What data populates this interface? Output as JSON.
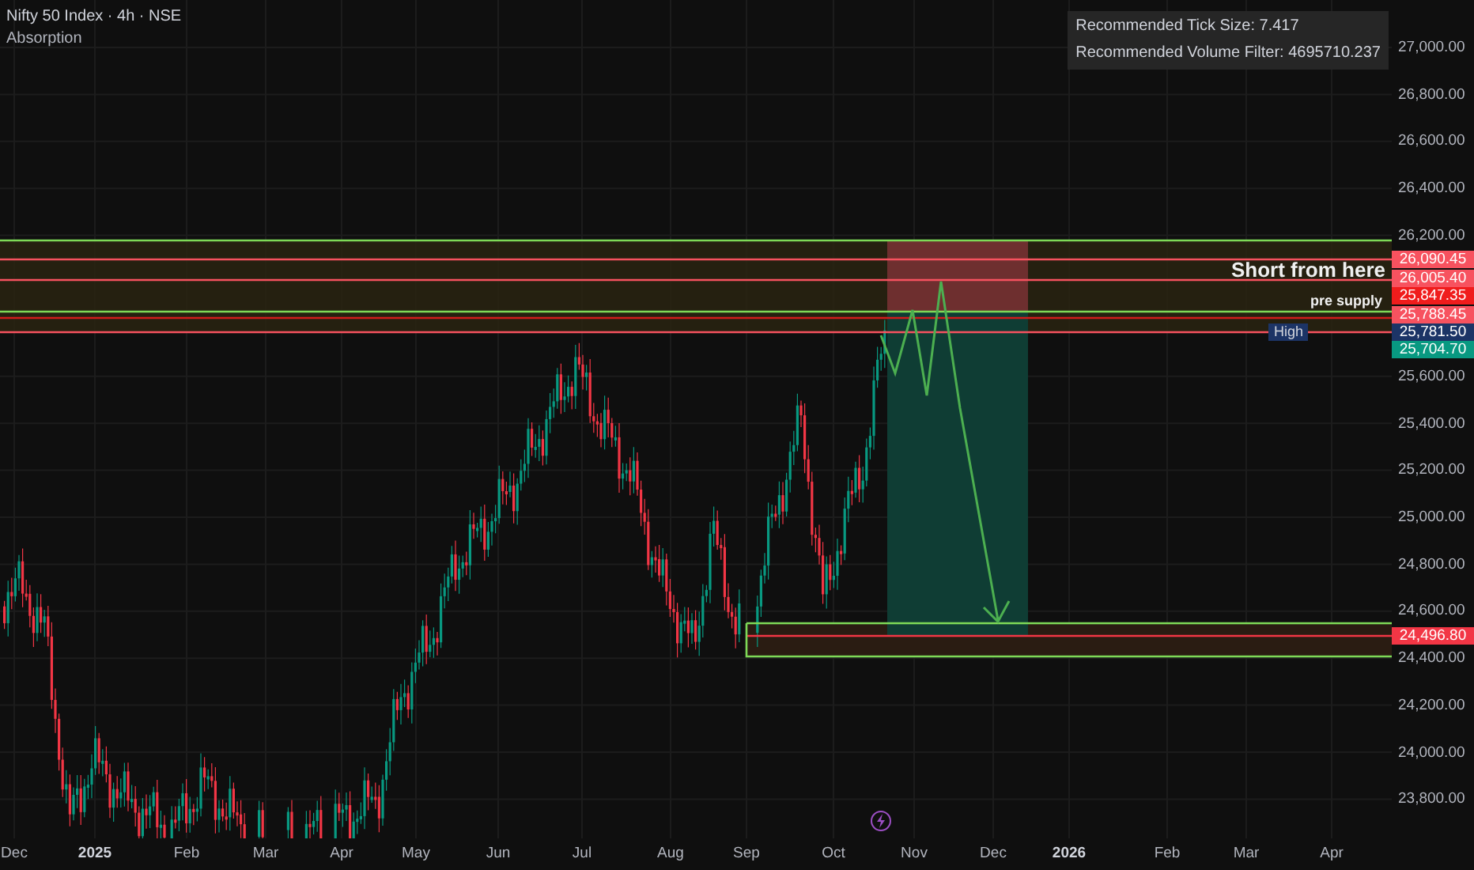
{
  "header": {
    "title": "Nifty 50 Index · 4h · NSE",
    "indicator": "Absorption"
  },
  "info_panel": [
    "Recommended Tick Size: 7.417",
    "Recommended Volume Filter: 4695710.237"
  ],
  "annotations": [
    {
      "kind": "headline",
      "text": "Short from here"
    },
    {
      "kind": "note",
      "text": "pre supply"
    }
  ],
  "price_axis": {
    "ticks": [
      "27,000.00",
      "26,800.00",
      "26,600.00",
      "26,400.00",
      "26,200.00",
      "25,600.00",
      "25,400.00",
      "25,200.00",
      "25,000.00",
      "24,800.00",
      "24,600.00",
      "24,400.00",
      "24,200.00",
      "24,000.00",
      "23,800.00"
    ],
    "tags": [
      {
        "label": "26,090.45",
        "color": "#f7525f"
      },
      {
        "label": "26,005.40",
        "color": "#f7525f"
      },
      {
        "label": "25,847.35",
        "color": "#f01c1c"
      },
      {
        "label": "25,788.45",
        "color": "#f7525f"
      },
      {
        "badge": "High",
        "label": "25,781.50",
        "color": "#1c3466"
      },
      {
        "label": "25,704.70",
        "color": "#089981"
      },
      {
        "label": "24,496.80",
        "color": "#f23645"
      }
    ]
  },
  "time_axis": [
    {
      "text": "Dec",
      "kind": "month"
    },
    {
      "text": "2025",
      "kind": "year"
    },
    {
      "text": "Feb",
      "kind": "month"
    },
    {
      "text": "Mar",
      "kind": "month"
    },
    {
      "text": "Apr",
      "kind": "month"
    },
    {
      "text": "May",
      "kind": "month"
    },
    {
      "text": "Jun",
      "kind": "month"
    },
    {
      "text": "Jul",
      "kind": "month"
    },
    {
      "text": "Aug",
      "kind": "month"
    },
    {
      "text": "Sep",
      "kind": "month"
    },
    {
      "text": "Oct",
      "kind": "month"
    },
    {
      "text": "Nov",
      "kind": "month"
    },
    {
      "text": "Dec",
      "kind": "month"
    },
    {
      "text": "2026",
      "kind": "year"
    },
    {
      "text": "Feb",
      "kind": "month"
    },
    {
      "text": "Mar",
      "kind": "month"
    },
    {
      "text": "Apr",
      "kind": "month"
    }
  ]
}
